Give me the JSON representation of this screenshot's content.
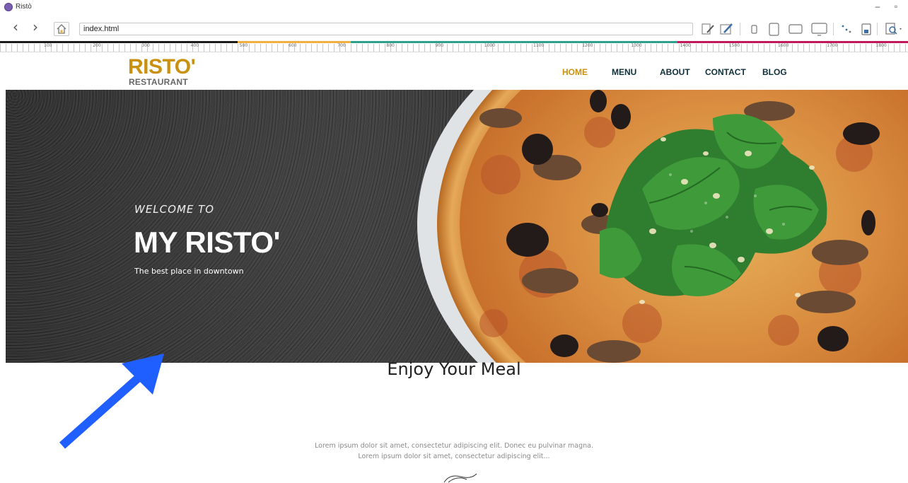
{
  "app": {
    "title": "Ristò",
    "address": "index.html",
    "icons": [
      "back-icon",
      "forward-icon",
      "home-icon",
      "edit-page-icon",
      "pen-icon",
      "phone-portrait-icon",
      "tablet-portrait-icon",
      "tablet-landscape-icon",
      "desktop-icon",
      "responsive-icon",
      "properties-icon",
      "preview-icon"
    ]
  },
  "ruler": {
    "labels": [
      "100",
      "200",
      "300",
      "400",
      "500",
      "600",
      "700",
      "800",
      "900",
      "1000",
      "1100",
      "1200",
      "1300",
      "1400",
      "1500",
      "1600",
      "1700",
      "1800"
    ],
    "stripe_colors": [
      "#1a1a1a",
      "#f0b040",
      "#2e9e8e",
      "#c2185b"
    ]
  },
  "site": {
    "logo": {
      "name": "RISTO'",
      "tagline": "RESTAURANT"
    },
    "nav": [
      {
        "label": "HOME",
        "active": true
      },
      {
        "label": "MENU",
        "active": false
      },
      {
        "label": "ABOUT",
        "active": false
      },
      {
        "label": "CONTACT",
        "active": false
      },
      {
        "label": "BLOG",
        "active": false
      }
    ],
    "hero": {
      "welcome": "WELCOME TO",
      "title": "MY RISTO'",
      "subtitle": "The best place in downtown"
    },
    "section": {
      "heading": "Enjoy Your Meal",
      "text_line1": "Lorem ipsum dolor sit amet, consectetur adipiscing elit. Donec eu pulvinar magna.",
      "text_line2": "Lorem ipsum dolor sit amet, consectetur adipiscing elit..."
    }
  },
  "colors": {
    "brand": "#c9910f",
    "nav_text": "#0f2f3a",
    "annotation_arrow": "#1f5fff"
  }
}
